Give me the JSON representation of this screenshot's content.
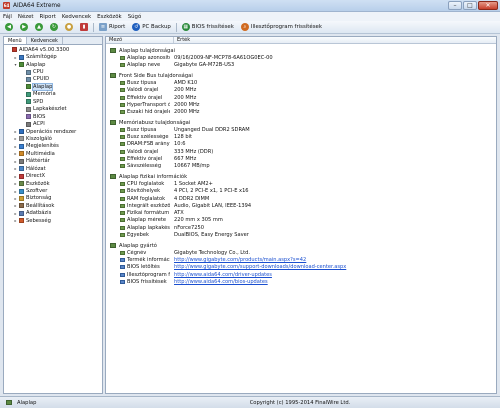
{
  "window": {
    "title": "AIDA64 Extreme",
    "app_icon": "64",
    "buttons": {
      "minimize": "–",
      "maximize": "□",
      "close": "✕"
    }
  },
  "menu": [
    "Fájl",
    "Nézet",
    "Riport",
    "Kedvencek",
    "Eszközök",
    "Súgó"
  ],
  "toolbar": {
    "report": "Riport",
    "pcbackup": "PC Backup",
    "bios": "BIOS frissítések",
    "drivers": "Illesztőprogram frissítések"
  },
  "left": {
    "tabs": [
      "Menü",
      "Kedvencek"
    ],
    "tree": [
      {
        "label": "AIDA64 v5.00.3300",
        "indent": 0,
        "exp": "",
        "color": "#c0392b"
      },
      {
        "label": "Számítógép",
        "indent": 1,
        "exp": "▸",
        "color": "#3a78c2"
      },
      {
        "label": "Alaplap",
        "indent": 1,
        "exp": "▾",
        "color": "#4f8d3a"
      },
      {
        "label": "CPU",
        "indent": 2,
        "exp": "",
        "color": "#6f8fa8"
      },
      {
        "label": "CPUID",
        "indent": 2,
        "exp": "",
        "color": "#6f8fa8"
      },
      {
        "label": "Alaplap",
        "indent": 2,
        "exp": "",
        "color": "#4f8d3a",
        "sel": true
      },
      {
        "label": "Memória",
        "indent": 2,
        "exp": "",
        "color": "#3f9a7a"
      },
      {
        "label": "SPD",
        "indent": 2,
        "exp": "",
        "color": "#3f9a7a"
      },
      {
        "label": "Lapkakészlet",
        "indent": 2,
        "exp": "",
        "color": "#8a8a8a"
      },
      {
        "label": "BIOS",
        "indent": 2,
        "exp": "",
        "color": "#8a6bb0"
      },
      {
        "label": "ACPI",
        "indent": 2,
        "exp": "",
        "color": "#7a7a7a"
      },
      {
        "label": "Operációs rendszer",
        "indent": 1,
        "exp": "▸",
        "color": "#2f6fbf"
      },
      {
        "label": "Kiszolgáló",
        "indent": 1,
        "exp": "▸",
        "color": "#9a9a9a"
      },
      {
        "label": "Megjelenítés",
        "indent": 1,
        "exp": "▸",
        "color": "#3a7fd0"
      },
      {
        "label": "Multimédia",
        "indent": 1,
        "exp": "▸",
        "color": "#d08a2a"
      },
      {
        "label": "Háttértár",
        "indent": 1,
        "exp": "▸",
        "color": "#7a7a7a"
      },
      {
        "label": "Hálózat",
        "indent": 1,
        "exp": "▸",
        "color": "#4a86c8"
      },
      {
        "label": "DirectX",
        "indent": 1,
        "exp": "▸",
        "color": "#c03a3a"
      },
      {
        "label": "Eszközök",
        "indent": 1,
        "exp": "▸",
        "color": "#6a8a4a"
      },
      {
        "label": "Szoftver",
        "indent": 1,
        "exp": "▸",
        "color": "#3a90c8"
      },
      {
        "label": "Biztonság",
        "indent": 1,
        "exp": "▸",
        "color": "#d0a030"
      },
      {
        "label": "Beállítások",
        "indent": 1,
        "exp": "▸",
        "color": "#8a6a4a"
      },
      {
        "label": "Adatbázis",
        "indent": 1,
        "exp": "▸",
        "color": "#5a7ab0"
      },
      {
        "label": "Sebesség",
        "indent": 1,
        "exp": "▸",
        "color": "#d05a2a"
      }
    ]
  },
  "main": {
    "col_field": "Mező",
    "col_value": "Érték",
    "sections": [
      {
        "title": "Alaplap tulajdonságai",
        "rows": [
          {
            "f": "Alaplap azonosítója",
            "v": "09/16/2009-NF-MCP78-6A61OG0EC-00"
          },
          {
            "f": "Alaplap neve",
            "v": "Gigabyte GA-M72B-US3"
          }
        ]
      },
      {
        "title": "Front Side Bus tulajdonságai",
        "rows": [
          {
            "f": "Busz típusa",
            "v": "AMD K10"
          },
          {
            "f": "Valódi órajel",
            "v": "200 MHz"
          },
          {
            "f": "Effektív órajel",
            "v": "200 MHz"
          },
          {
            "f": "HyperTransport órajel",
            "v": "2000 MHz"
          },
          {
            "f": "Északi híd órajele",
            "v": "2000 MHz"
          }
        ]
      },
      {
        "title": "Memóriabusz tulajdonságai",
        "rows": [
          {
            "f": "Busz típusa",
            "v": "Unganged Dual DDR2 SDRAM"
          },
          {
            "f": "Busz szélessége",
            "v": "128 bit"
          },
          {
            "f": "DRAM:FSB arány",
            "v": "10:6"
          },
          {
            "f": "Valódi órajel",
            "v": "333 MHz (DDR)"
          },
          {
            "f": "Effektív órajel",
            "v": "667 MHz"
          },
          {
            "f": "Sávszélesség",
            "v": "10667 MB/mp"
          }
        ]
      },
      {
        "title": "Alaplap fizikai információk",
        "rows": [
          {
            "f": "CPU foglalatok",
            "v": "1 Socket AM2+"
          },
          {
            "f": "Bővítőhelyek",
            "v": "4 PCI, 2 PCI-E x1, 1 PCI-E x16"
          },
          {
            "f": "RAM foglalatok",
            "v": "4 DDR2 DIMM"
          },
          {
            "f": "Integrált eszközök",
            "v": "Audio, Gigabit LAN, IEEE-1394"
          },
          {
            "f": "Fizikai formátum",
            "v": "ATX"
          },
          {
            "f": "Alaplap mérete",
            "v": "220 mm x 305 mm"
          },
          {
            "f": "Alaplap lapkakészlet",
            "v": "nForce7250"
          },
          {
            "f": "Egyebek",
            "v": "DualBIOS, Easy Energy Saver"
          }
        ]
      },
      {
        "title": "Alaplap gyártó",
        "rows": [
          {
            "f": "Cégnév",
            "v": "Gigabyte Technology Co., Ltd."
          },
          {
            "f": "Termék információ",
            "v": "http://www.gigabyte.com/products/main.aspx?s=42",
            "link": true
          },
          {
            "f": "BIOS letöltés",
            "v": "http://www.gigabyte.com/support-downloads/download-center.aspx",
            "link": true
          },
          {
            "f": "Illesztőprogram frissítés",
            "v": "http://www.aida64.com/driver-updates",
            "link": true
          },
          {
            "f": "BIOS frissítések",
            "v": "http://www.aida64.com/bios-updates",
            "link": true
          }
        ]
      }
    ]
  },
  "status": {
    "left": "Alaplap",
    "center": "Copyright (c) 1995-2014 FinalWire Ltd."
  }
}
